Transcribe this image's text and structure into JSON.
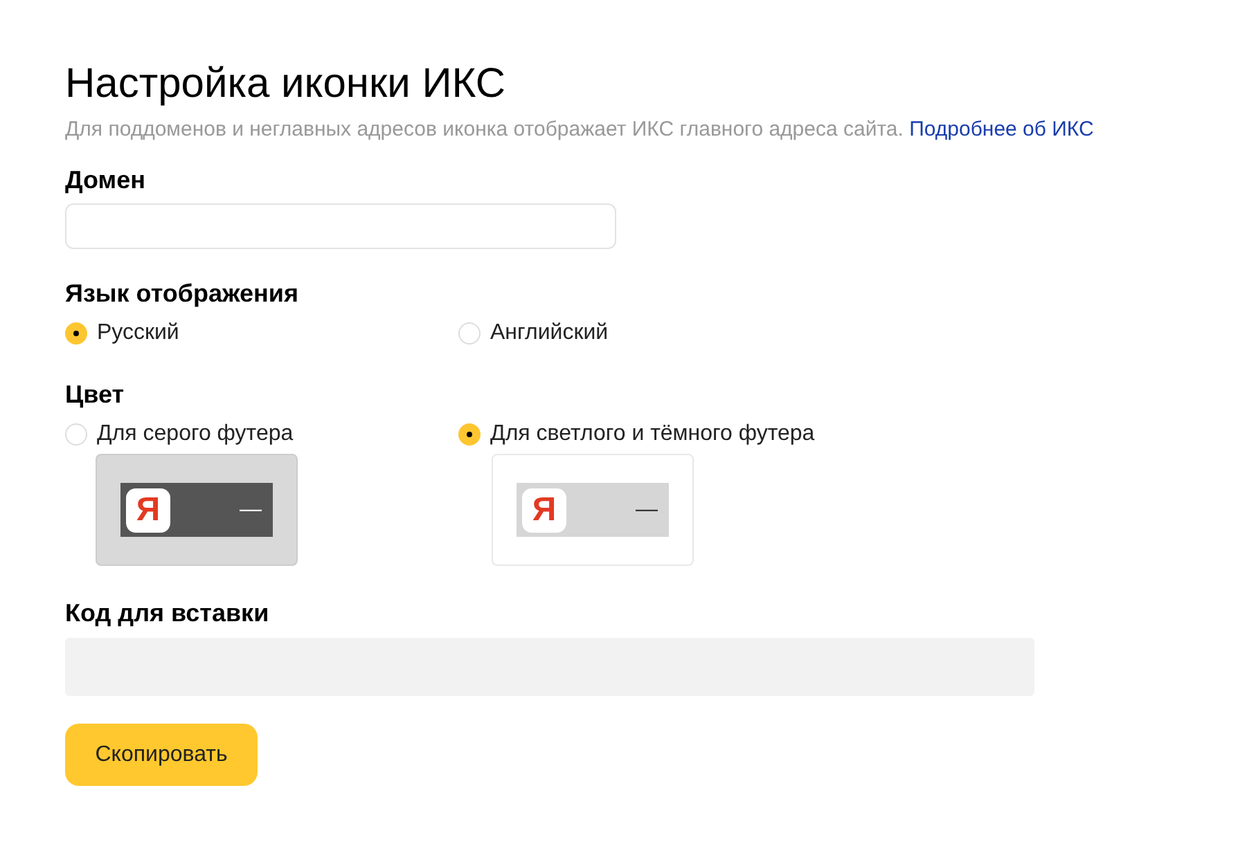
{
  "title": "Настройка иконки ИКС",
  "subtitle": {
    "text": "Для поддоменов и неглавных адресов иконка отображает ИКС главного адреса сайта.",
    "link": "Подробнее об ИКС"
  },
  "domain": {
    "label": "Домен"
  },
  "language": {
    "label": "Язык отображения",
    "options": [
      {
        "label": "Русский",
        "selected": true
      },
      {
        "label": "Английский",
        "selected": false
      }
    ]
  },
  "color": {
    "label": "Цвет",
    "options": [
      {
        "label": "Для серого футера",
        "selected": false,
        "kind": "grey",
        "logo": "Я",
        "mark": "—"
      },
      {
        "label": "Для светлого и тёмного футера",
        "selected": true,
        "kind": "light",
        "logo": "Я",
        "mark": "—"
      }
    ]
  },
  "code": {
    "label": "Код для вставки"
  },
  "button": "Скопировать"
}
